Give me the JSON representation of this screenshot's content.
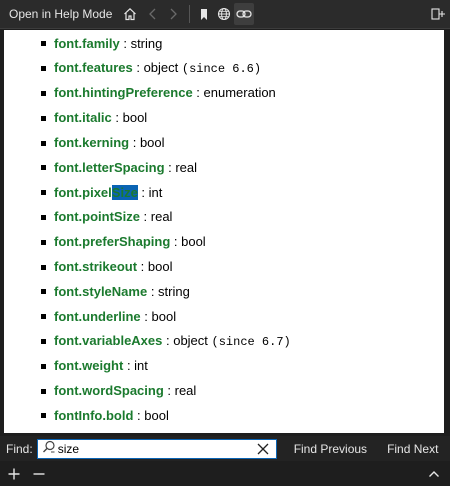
{
  "toolbar": {
    "help_mode_label": "Open in Help Mode",
    "icons": [
      "home-icon",
      "back-icon",
      "forward-icon",
      "bookmark-icon",
      "globe-icon",
      "link-icon",
      "split-view-icon"
    ]
  },
  "properties": [
    {
      "name": "font.family",
      "rest": " : string",
      "since": ""
    },
    {
      "name": "font.features",
      "rest": " : object ",
      "since": "(since 6.6)"
    },
    {
      "name": "font.hintingPreference",
      "rest": " : enumeration",
      "since": ""
    },
    {
      "name": "font.italic",
      "rest": " : bool",
      "since": ""
    },
    {
      "name": "font.kerning",
      "rest": " : bool",
      "since": ""
    },
    {
      "name": "font.letterSpacing",
      "rest": " : real",
      "since": ""
    },
    {
      "name_pre": "font.pixel",
      "name_match": "Size",
      "rest": " : int",
      "since": ""
    },
    {
      "name": "font.pointSize",
      "rest": " : real",
      "since": ""
    },
    {
      "name": "font.preferShaping",
      "rest": " : bool",
      "since": ""
    },
    {
      "name": "font.strikeout",
      "rest": " : bool",
      "since": ""
    },
    {
      "name": "font.styleName",
      "rest": " : string",
      "since": ""
    },
    {
      "name": "font.underline",
      "rest": " : bool",
      "since": ""
    },
    {
      "name": "font.variableAxes",
      "rest": " : object ",
      "since": "(since 6.7)"
    },
    {
      "name": "font.weight",
      "rest": " : int",
      "since": ""
    },
    {
      "name": "font.wordSpacing",
      "rest": " : real",
      "since": ""
    },
    {
      "name": "fontInfo.bold",
      "rest": " : bool",
      "since": ""
    }
  ],
  "find": {
    "label": "Find:",
    "value": "size",
    "prev_label": "Find Previous",
    "next_label": "Find Next"
  },
  "colors": {
    "property_name": "#1b7a2e",
    "highlight": "#0a64b4"
  }
}
